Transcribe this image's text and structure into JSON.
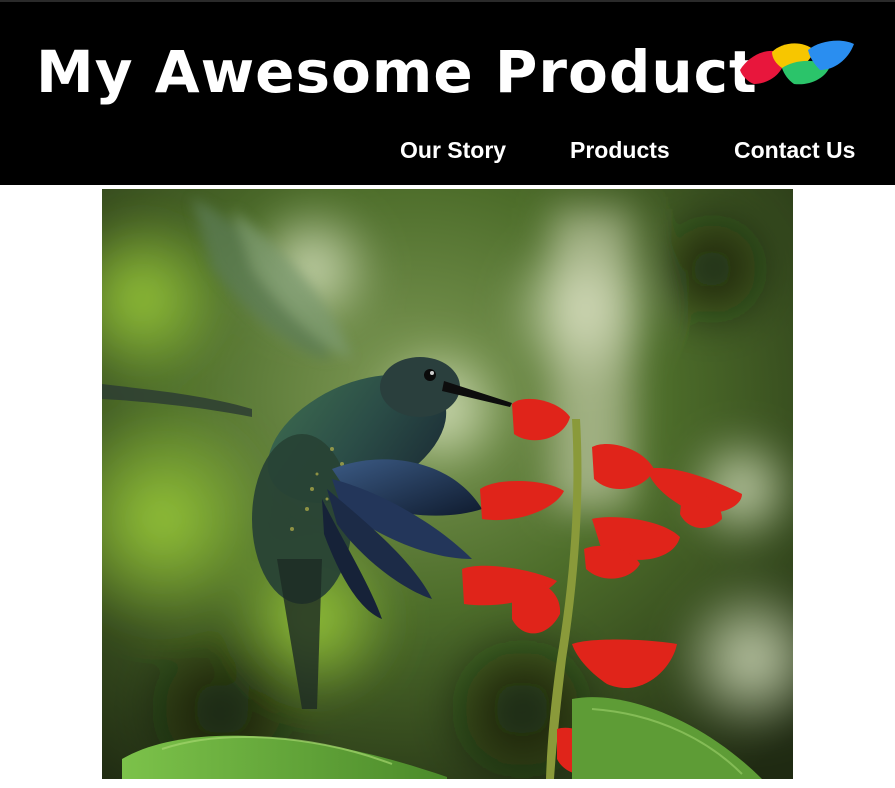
{
  "header": {
    "title": "My Awesome Product",
    "logo_icon": "tricolor-petal-logo-icon",
    "logo_colors": [
      "#e8163c",
      "#f7c600",
      "#2bc46a",
      "#2a8ef0"
    ]
  },
  "nav": {
    "items": [
      {
        "label": "Our Story"
      },
      {
        "label": "Products"
      },
      {
        "label": "Contact Us"
      }
    ]
  },
  "hero": {
    "image_icon": "hummingbird-photo"
  },
  "colors": {
    "header_bg": "#000000",
    "header_text": "#ffffff",
    "page_bg": "#ffffff"
  }
}
